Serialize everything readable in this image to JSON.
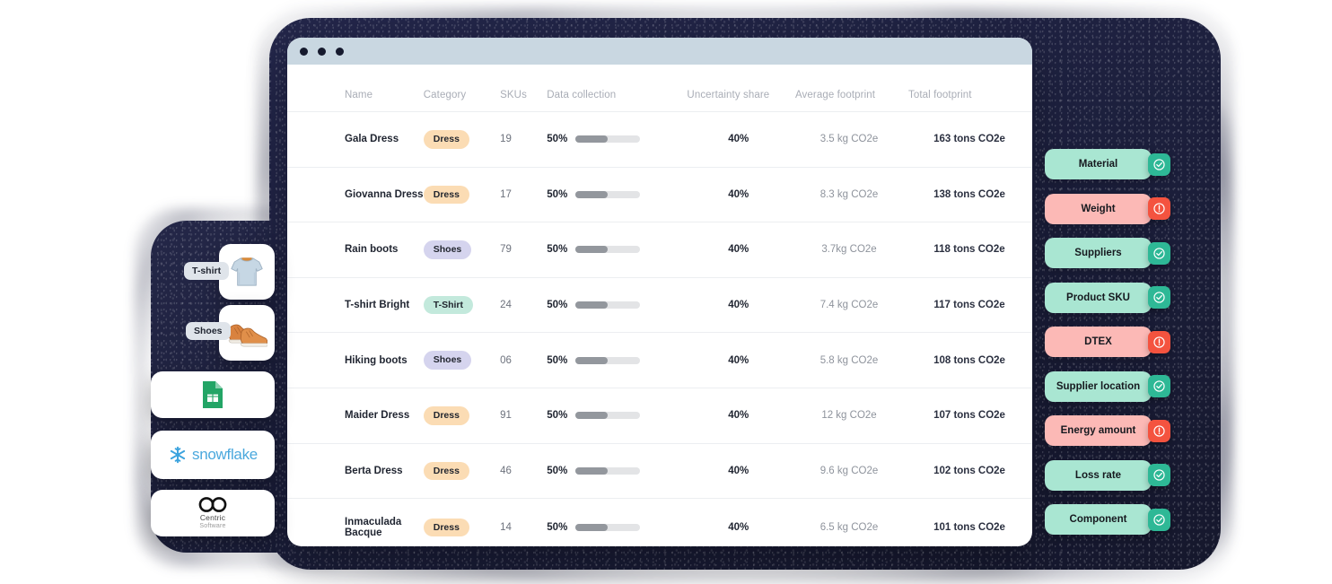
{
  "window": {
    "traffic_lights": [
      "red-dot",
      "yellow-dot",
      "green-dot"
    ]
  },
  "table": {
    "columns": [
      {
        "key": "name",
        "label": "Name"
      },
      {
        "key": "cat",
        "label": "Category"
      },
      {
        "key": "sku",
        "label": "SKUs"
      },
      {
        "key": "data",
        "label": "Data collection"
      },
      {
        "key": "unc",
        "label": "Uncertainty share"
      },
      {
        "key": "avg",
        "label": "Average footprint"
      },
      {
        "key": "tot",
        "label": "Total footprint"
      }
    ],
    "rows": [
      {
        "name": "Gala Dress",
        "cat": "Dress",
        "cat_type": "dress",
        "sku": "19",
        "data_pct": "50%",
        "data_value": 50,
        "unc": "40%",
        "avg": "3.5 kg CO2e",
        "tot": "163 tons CO2e"
      },
      {
        "name": "Giovanna Dress",
        "cat": "Dress",
        "cat_type": "dress",
        "sku": "17",
        "data_pct": "50%",
        "data_value": 50,
        "unc": "40%",
        "avg": "8.3 kg CO2e",
        "tot": "138 tons CO2e"
      },
      {
        "name": "Rain boots",
        "cat": "Shoes",
        "cat_type": "shoes",
        "sku": "79",
        "data_pct": "50%",
        "data_value": 50,
        "unc": "40%",
        "avg": "3.7kg CO2e",
        "tot": "118 tons CO2e"
      },
      {
        "name": "T-shirt Bright",
        "cat": "T-Shirt",
        "cat_type": "tshirt",
        "sku": "24",
        "data_pct": "50%",
        "data_value": 50,
        "unc": "40%",
        "avg": "7.4 kg CO2e",
        "tot": "117 tons CO2e"
      },
      {
        "name": "Hiking boots",
        "cat": "Shoes",
        "cat_type": "shoes",
        "sku": "06",
        "data_pct": "50%",
        "data_value": 50,
        "unc": "40%",
        "avg": "5.8 kg CO2e",
        "tot": "108 tons CO2e"
      },
      {
        "name": "Maider Dress",
        "cat": "Dress",
        "cat_type": "dress",
        "sku": "91",
        "data_pct": "50%",
        "data_value": 50,
        "unc": "40%",
        "avg": "12 kg CO2e",
        "tot": "107 tons CO2e"
      },
      {
        "name": "Berta Dress",
        "cat": "Dress",
        "cat_type": "dress",
        "sku": "46",
        "data_pct": "50%",
        "data_value": 50,
        "unc": "40%",
        "avg": "9.6 kg CO2e",
        "tot": "102 tons CO2e"
      },
      {
        "name": "Inmaculada Bacque",
        "cat": "Dress",
        "cat_type": "dress",
        "sku": "14",
        "data_pct": "50%",
        "data_value": 50,
        "unc": "40%",
        "avg": "6.5 kg CO2e",
        "tot": "101 tons CO2e"
      }
    ]
  },
  "left_stack": {
    "product_cards": [
      {
        "chip": "T-shirt",
        "icon": "tshirt-thumbnail"
      },
      {
        "chip": "Shoes",
        "icon": "shoes-thumbnail"
      }
    ],
    "integrations": [
      {
        "name": "google-sheets-logo",
        "label": ""
      },
      {
        "name": "snowflake-logo",
        "label": "snowflake"
      },
      {
        "name": "centric-software-logo",
        "label_top": "Centric",
        "label_bottom": "Software"
      }
    ]
  },
  "attributes": {
    "items": [
      {
        "label": "Material",
        "status": "ok",
        "icon": "check-circle-icon"
      },
      {
        "label": "Weight",
        "status": "warn",
        "icon": "alert-circle-icon"
      },
      {
        "label": "Suppliers",
        "status": "ok",
        "icon": "check-circle-icon"
      },
      {
        "label": "Product SKU",
        "status": "ok",
        "icon": "check-circle-icon"
      },
      {
        "label": "DTEX",
        "status": "warn",
        "icon": "alert-circle-icon"
      },
      {
        "label": "Supplier location",
        "status": "ok",
        "icon": "check-circle-icon"
      },
      {
        "label": "Energy amount",
        "status": "warn",
        "icon": "alert-circle-icon"
      },
      {
        "label": "Loss rate",
        "status": "ok",
        "icon": "check-circle-icon"
      },
      {
        "label": "Component",
        "status": "ok",
        "icon": "check-circle-icon"
      }
    ]
  },
  "colors": {
    "backdrop": "#1c1f3c",
    "titlebar": "#c9d7e1",
    "badge_dress": "#fbdcb4",
    "badge_shoes": "#d5d4ee",
    "badge_tshirt": "#c3e9dc",
    "pill_ok": "#a9e6d2",
    "pill_warn": "#fcb9b6",
    "status_ok": "#2eb896",
    "status_warn": "#f4533f",
    "progress_fill": "#93979d",
    "progress_track": "#e3e4e6"
  }
}
